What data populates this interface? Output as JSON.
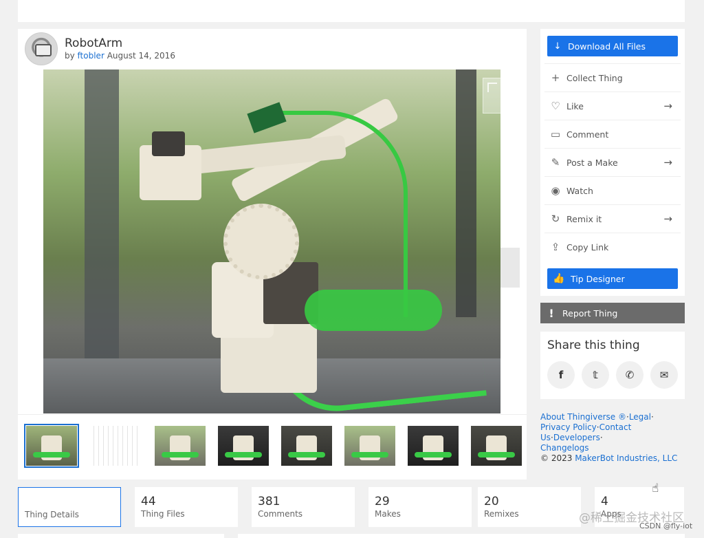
{
  "thing": {
    "title": "RobotArm",
    "by_prefix": "by",
    "author": "ftobler",
    "date": "August 14, 2016"
  },
  "actions": {
    "download": "Download All Files",
    "collect": "Collect Thing",
    "like": "Like",
    "comment": "Comment",
    "post_make": "Post a Make",
    "watch": "Watch",
    "remix": "Remix it",
    "copy_link": "Copy Link",
    "tip": "Tip Designer",
    "report": "Report Thing"
  },
  "share": {
    "title": "Share this thing",
    "networks": [
      "facebook-icon",
      "twitter-icon",
      "whatsapp-icon",
      "mail-icon"
    ]
  },
  "footer": {
    "about": "About Thingiverse ®",
    "legal": "Legal",
    "privacy": "Privacy Policy",
    "contact": "Contact Us",
    "developers": "Developers",
    "changelogs": "Changelogs",
    "copyright": "©  2023",
    "company": "MakerBot Industries, LLC"
  },
  "stats": [
    {
      "num": "",
      "label": "Thing Details"
    },
    {
      "num": "44",
      "label": "Thing Files"
    },
    {
      "num": "381",
      "label": "Comments"
    },
    {
      "num": "29",
      "label": "Makes"
    },
    {
      "num": "20",
      "label": "Remixes"
    },
    {
      "num": "4",
      "label": "Apps"
    }
  ],
  "overlay": {
    "watermark": "@稀土掘金技术社区",
    "csdn": "CSDN @fly-iot"
  },
  "colors": {
    "accent": "#1a73e8",
    "link": "#1a6fd1",
    "report_bg": "#6b6b6b"
  }
}
